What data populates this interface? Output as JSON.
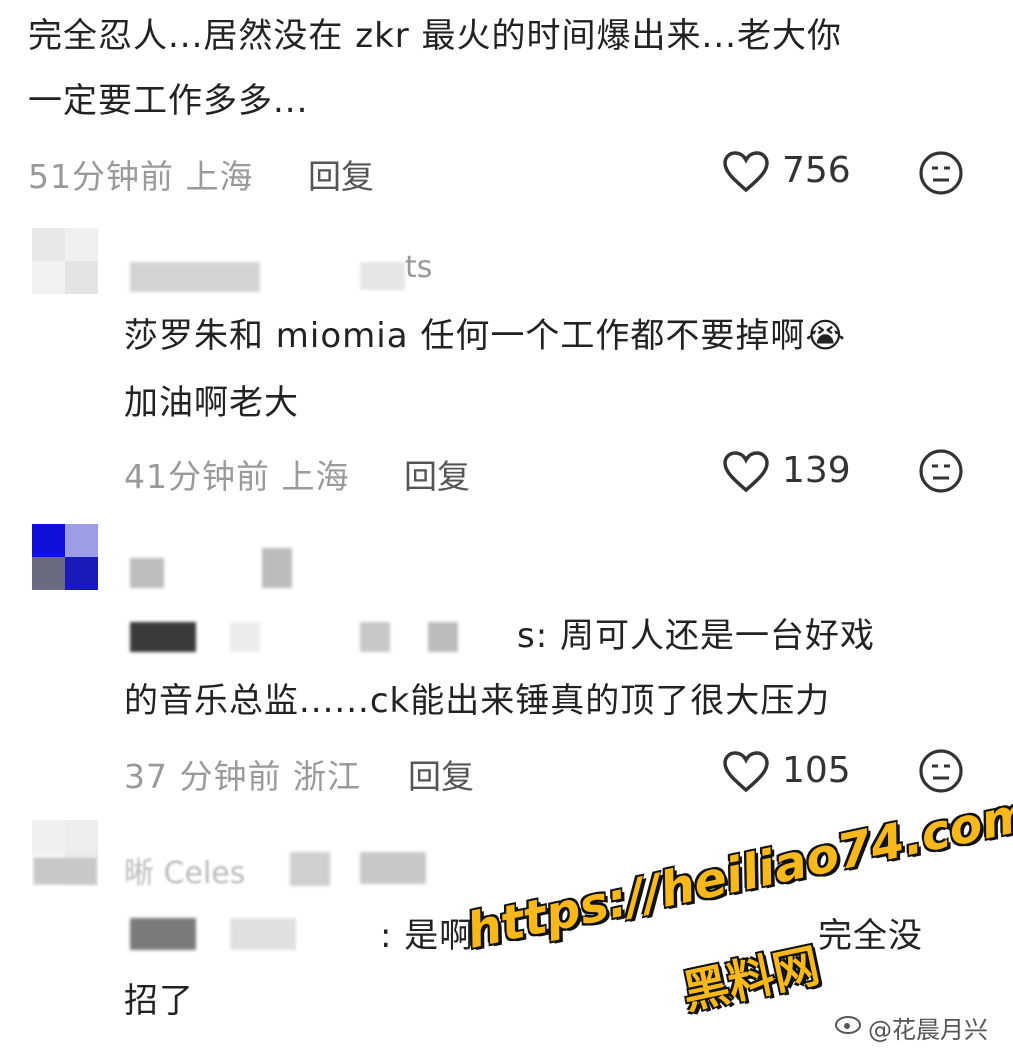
{
  "comments": [
    {
      "text_lines": [
        "完全忍人...居然没在 zkr 最火的时间爆出来...老大你",
        "一定要工作多多..."
      ],
      "meta": "51分钟前 上海",
      "reply": "回复",
      "likes": "756"
    },
    {
      "username_suffix": "ts",
      "text_lines": [
        "莎罗朱和 miomia 任何一个工作都不要掉啊😭",
        "加油啊老大"
      ],
      "meta": "41分钟前 上海",
      "reply": "回复",
      "likes": "139"
    },
    {
      "text_lines": [
        "s: 周可人还是一台好戏",
        "的音乐总监......ck能出来锤真的顶了很大压力"
      ],
      "meta": "37 分钟前 浙江",
      "reply": "回复",
      "likes": "105"
    },
    {
      "username_partial": "晰 Celes",
      "text_lines": [
        ": 是啊",
        "招了"
      ],
      "text_partial_right": "完全没"
    }
  ],
  "watermark": {
    "url": "https://heiliao74.com",
    "cn": "黑料网"
  },
  "weibo": "@花晨月兴",
  "colors": {
    "watermark": "#f7b81c",
    "meta": "#9a9a9a"
  }
}
